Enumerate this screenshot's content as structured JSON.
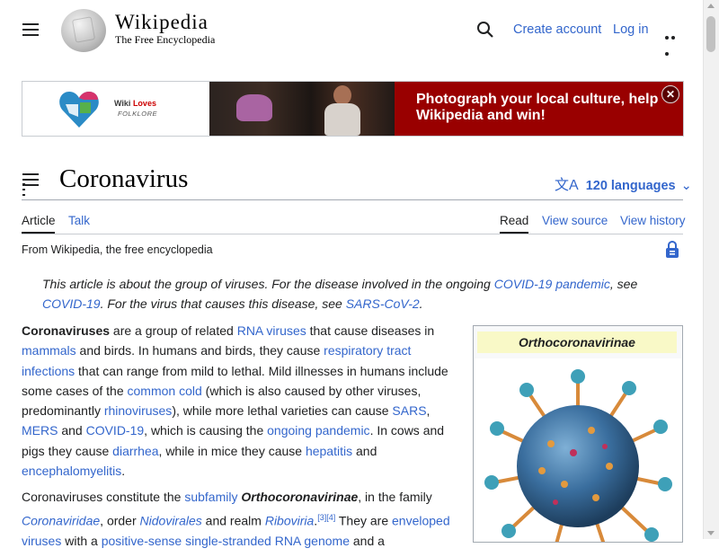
{
  "header": {
    "wordmark": "Wikipedia",
    "tagline": "The Free Encyclopedia",
    "create_account": "Create account",
    "log_in": "Log in"
  },
  "banner": {
    "logo_title_prefix": "Wiki ",
    "logo_title_accent": "Loves",
    "logo_subtitle": "FOLKLORE",
    "cta": "Photograph your local culture, help Wikipedia and win!",
    "close_glyph": "✕"
  },
  "article": {
    "title": "Coronavirus",
    "languages": "120 languages",
    "tabs": {
      "article": "Article",
      "talk": "Talk",
      "read": "Read",
      "view_source": "View source",
      "view_history": "View history"
    },
    "from": "From Wikipedia, the free encyclopedia",
    "hatnote": {
      "t1": "This article is about the group of viruses. For the disease involved in the ongoing ",
      "l1": "COVID-19 pandemic",
      "t2": ", see ",
      "l2": "COVID-19",
      "t3": ". For the virus that causes this disease, see ",
      "l3": "SARS-CoV-2",
      "t4": "."
    },
    "p1": {
      "b1": "Coronaviruses",
      "t1": " are a group of related ",
      "l1": "RNA viruses",
      "t2": " that cause diseases in ",
      "l2": "mammals",
      "t3": " and birds. In humans and birds, they cause ",
      "l3": "respiratory tract infections",
      "t4": " that can range from mild to lethal. Mild illnesses in humans include some cases of the ",
      "l4": "common cold",
      "t5": " (which is also caused by other viruses, predominantly ",
      "l5": "rhinoviruses",
      "t6": "), while more lethal varieties can cause ",
      "l6": "SARS",
      "t7": ", ",
      "l7": "MERS",
      "t8": " and ",
      "l8": "COVID-19",
      "t9": ", which is causing the ",
      "l9": "ongoing pandemic",
      "t10": ". In cows and pigs they cause ",
      "l10": "diarrhea",
      "t11": ", while in mice they cause ",
      "l11": "hepatitis",
      "t12": " and ",
      "l12": "encephalomyelitis",
      "t13": "."
    },
    "p2": {
      "t1": "Coronaviruses constitute the ",
      "l1": "subfamily",
      "t2": " ",
      "b1": "Orthocoronavirinae",
      "t3": ", in the family ",
      "l2": "Coronaviridae",
      "t4": ", order ",
      "l3": "Nidovirales",
      "t5": " and realm ",
      "l4": "Riboviria",
      "t6": ".",
      "sup1": "[3]",
      "sup2": "[4]",
      "t7": " They are ",
      "l5": "enveloped viruses",
      "t8": " with a ",
      "l6": "positive-sense single-stranded RNA genome",
      "t9": " and a"
    },
    "infobox": {
      "title": "Orthocoronavirinae"
    }
  },
  "colors": {
    "link": "#3366cc",
    "banner_red": "#990000",
    "infobox_title_bg": "#f9f9c7"
  }
}
